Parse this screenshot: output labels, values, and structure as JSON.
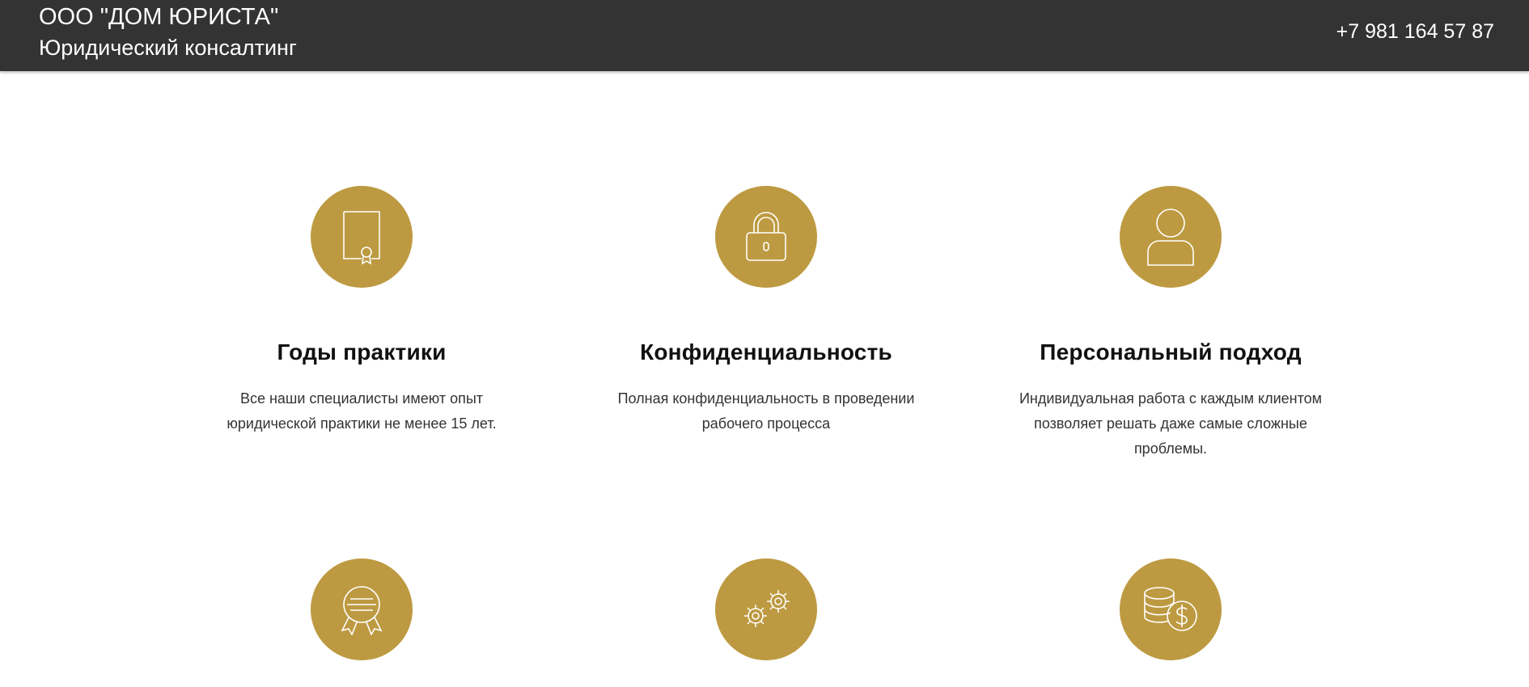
{
  "header": {
    "company_name": "ООО \"ДОМ ЮРИСТА\"",
    "tagline": "Юридический консалтинг",
    "phone": "+7 981 164 57 87"
  },
  "colors": {
    "header_bg": "#333333",
    "accent_gold": "#bd9a41",
    "text_dark": "#111111"
  },
  "features": [
    {
      "icon": "certificate-document-icon",
      "title": "Годы практики",
      "description": "Все наши специалисты имеют опыт юридической практики не менее 15 лет."
    },
    {
      "icon": "padlock-icon",
      "title": "Конфиденциальность",
      "description": "Полная конфиденциальность в проведении рабочего процесса"
    },
    {
      "icon": "user-icon",
      "title": "Персональный подход",
      "description": "Индивидуальная работа с каждым клиентом позволяет решать даже самые сложные проблемы."
    },
    {
      "icon": "award-badge-icon"
    },
    {
      "icon": "gears-icon"
    },
    {
      "icon": "coins-dollar-icon"
    }
  ]
}
